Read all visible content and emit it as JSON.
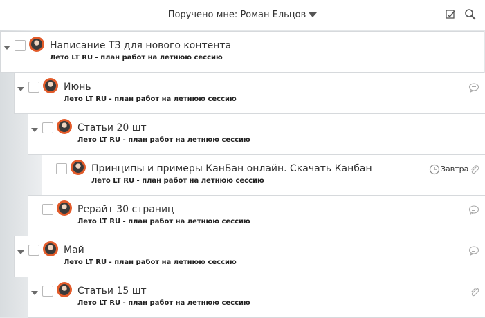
{
  "filter": {
    "label": "Поручено мне: Роман Ельцов"
  },
  "colors": {
    "accent": "#e25b2a",
    "row_bg": "#ffffff",
    "page_bg": "#e4e7e9"
  },
  "tasks": [
    {
      "title": "Написание ТЗ для нового контента",
      "project": "Лето LT RU - план работ на летнюю сессию",
      "expand_icon": "caret-down-icon",
      "right_icon": ""
    },
    {
      "title": "Июнь",
      "project": "Лето LT RU - план работ на летнюю сессию",
      "expand_icon": "caret-down-icon",
      "right_icon": "comment-icon"
    },
    {
      "title": "Статьи 20 шт",
      "project": "Лето LT RU - план работ на летнюю сессию",
      "expand_icon": "caret-down-icon",
      "right_icon": ""
    },
    {
      "title": "Принципы и примеры КанБан онлайн. Скачать Канбан",
      "project": "Лето LT RU - план работ на летнюю сессию",
      "due": "Завтра",
      "right_icon": "attachment-icon"
    },
    {
      "title": "Рерайт 30 страниц",
      "project": "Лето LT RU - план работ на летнюю сессию",
      "right_icon": "comment-icon"
    },
    {
      "title": "Май",
      "project": "Лето LT RU - план работ на летнюю сессию",
      "expand_icon": "caret-down-icon",
      "right_icon": "comment-icon"
    },
    {
      "title": "Статьи 15 шт",
      "project": "Лето LT RU - план работ на летнюю сессию",
      "expand_icon": "caret-down-icon",
      "right_icon": "attachment-icon"
    }
  ]
}
